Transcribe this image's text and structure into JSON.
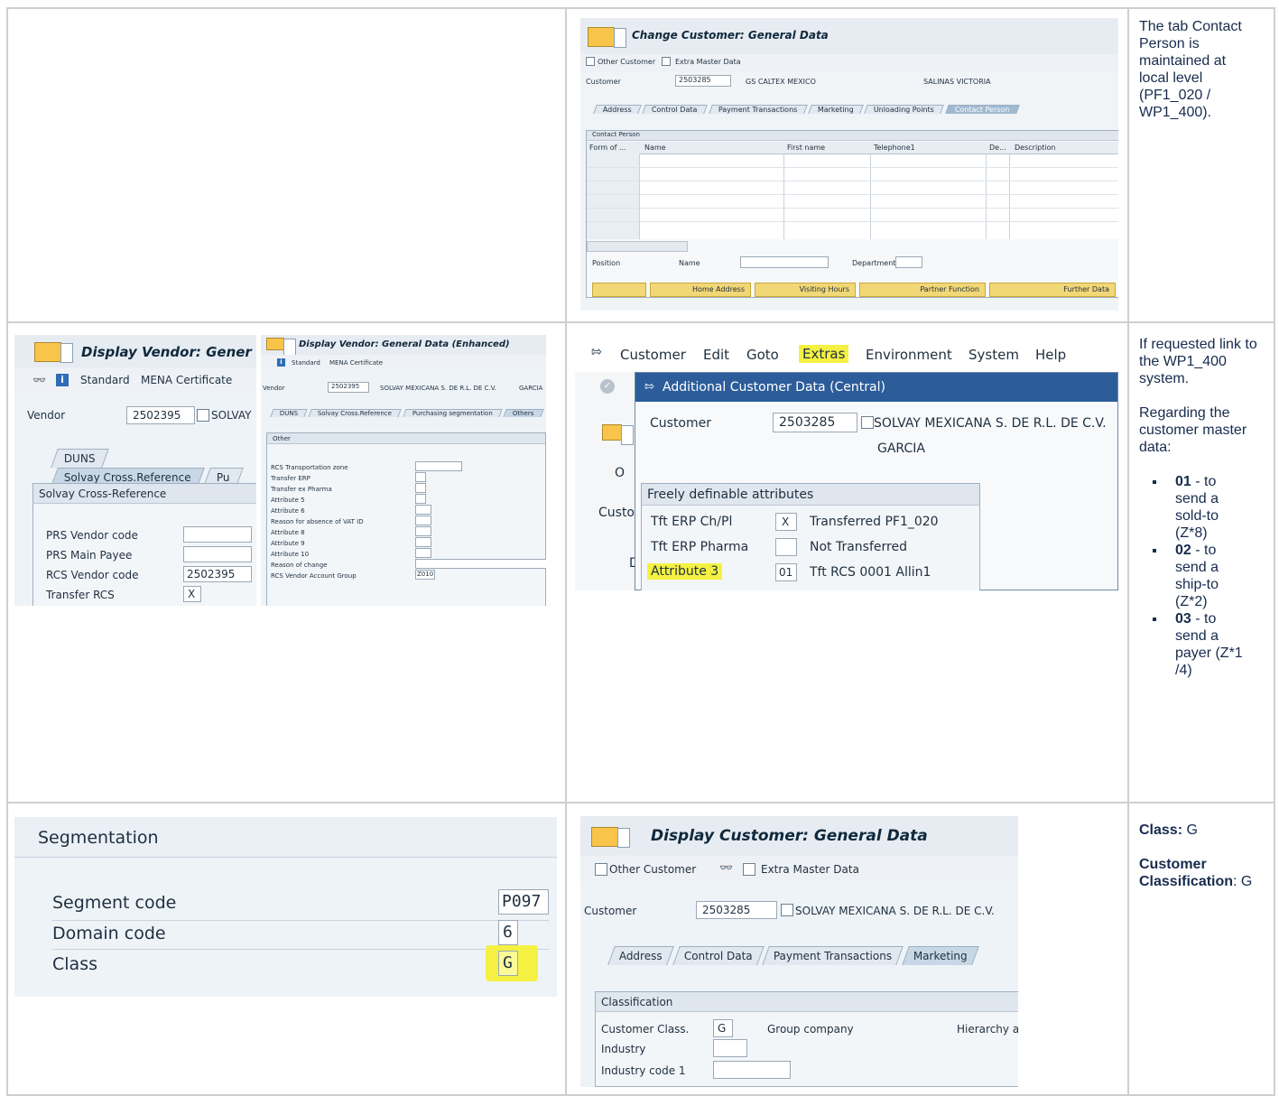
{
  "notes": {
    "row1": "The tab Contact Person is maintained at local level (PF1_020 / WP1_400).",
    "row2_p1": "If requested link to the WP1_400 system.",
    "row2_p2": "Regarding the customer master data:",
    "row2_items": [
      {
        "code": "01",
        "text": " - to send a sold-to (Z*8)"
      },
      {
        "code": "02",
        "text": " - to send a ship-to (Z*2)"
      },
      {
        "code": "03",
        "text": " - to send a payer (Z*1 /4)"
      }
    ],
    "row3_class_label": "Class:",
    "row3_class_value": " G",
    "row3_cc_label": "Customer Classification",
    "row3_cc_value": ": G"
  },
  "shot_change_customer": {
    "title": "Change Customer: General Data",
    "toolbar": [
      "Other Customer",
      "Extra Master Data"
    ],
    "customer_label": "Customer",
    "customer_no": "2503285",
    "customer_name": "GS CALTEX MEXICO",
    "city": "SALINAS VICTORIA",
    "tabs": [
      "Address",
      "Control Data",
      "Payment Transactions",
      "Marketing",
      "Unloading Points",
      "Contact Person"
    ],
    "group_title": "Contact Person",
    "columns": [
      "Form of ...",
      "Name",
      "First name",
      "Telephone1",
      "De...",
      "Description"
    ],
    "position_label": "Position",
    "name_label": "Name",
    "department_label": "Department",
    "buttons": [
      "Home Address",
      "Visiting Hours",
      "Partner Function",
      "Further Data"
    ]
  },
  "shot_vendor_large": {
    "title": "Display Vendor: Gener",
    "toolbar": [
      "Standard",
      "MENA Certificate"
    ],
    "vendor_label": "Vendor",
    "vendor_no": "2502395",
    "vendor_name": "SOLVAY",
    "tabs": [
      "DUNS",
      "Solvay Cross.Reference",
      "Pu"
    ],
    "group_title": "Solvay Cross-Reference",
    "fields": [
      {
        "label": "PRS Vendor code",
        "value": ""
      },
      {
        "label": "PRS Main Payee",
        "value": ""
      },
      {
        "label": "RCS Vendor code",
        "value": "2502395"
      },
      {
        "label": "Transfer RCS",
        "value": "X"
      }
    ]
  },
  "shot_vendor_small": {
    "title": "Display Vendor: General Data (Enhanced)",
    "toolbar": [
      "Standard",
      "MENA Certificate"
    ],
    "vendor_label": "Vendor",
    "vendor_no": "2502395",
    "vendor_name": "SOLVAY MEXICANA S. DE R.L. DE C.V.",
    "vendor_city": "GARCIA",
    "tabs": [
      "DUNS",
      "Solvay Cross.Reference",
      "Purchasing segmentation",
      "Others"
    ],
    "group_title": "Other",
    "fields": [
      {
        "label": "RCS Transportation zone",
        "value": ""
      },
      {
        "label": "Transfer ERP",
        "value": ""
      },
      {
        "label": "Transfer ex Pharma",
        "value": ""
      },
      {
        "label": "Attribute 5",
        "value": ""
      },
      {
        "label": "Attribute 6",
        "value": ""
      },
      {
        "label": "Reason for absence of VAT ID",
        "value": ""
      },
      {
        "label": "Attribute 8",
        "value": ""
      },
      {
        "label": "Attribute 9",
        "value": ""
      },
      {
        "label": "Attribute 10",
        "value": ""
      },
      {
        "label": "Reason of change",
        "value": ""
      },
      {
        "label": "RCS Vendor Account Group",
        "value": "Z010"
      }
    ]
  },
  "shot_additional": {
    "menu": [
      "Customer",
      "Edit",
      "Goto",
      "Extras",
      "Environment",
      "System",
      "Help"
    ],
    "dialog_title": "Additional Customer Data (Central)",
    "customer_label": "Customer",
    "customer_no": "2503285",
    "customer_name": "SOLVAY MEXICANA S. DE R.L. DE C.V.",
    "city": "GARCIA",
    "bg_fragments": [
      "O",
      "Custo",
      "D"
    ],
    "group_title": "Freely definable attributes",
    "rows": [
      {
        "label": "Tft ERP Ch/Pl",
        "value": "X",
        "desc": "Transferred PF1_020"
      },
      {
        "label": "Tft ERP Pharma",
        "value": "",
        "desc": "Not Transferred"
      },
      {
        "label": "Attribute 3",
        "value": "01",
        "desc": "Tft RCS 0001 Allin1"
      }
    ]
  },
  "shot_segmentation": {
    "title": "Segmentation",
    "fields": [
      {
        "label": "Segment code",
        "value": "P097"
      },
      {
        "label": "Domain code",
        "value": "6"
      },
      {
        "label": "Class",
        "value": "G"
      }
    ]
  },
  "shot_display_customer": {
    "title": "Display Customer: General Data",
    "toolbar": [
      "Other Customer",
      "Extra Master Data"
    ],
    "customer_label": "Customer",
    "customer_no": "2503285",
    "customer_name": "SOLVAY MEXICANA S. DE R.L. DE C.V.",
    "tabs": [
      "Address",
      "Control Data",
      "Payment Transactions",
      "Marketing"
    ],
    "group_title": "Classification",
    "fields": [
      {
        "label": "Customer Class.",
        "value": "G",
        "desc": "Group company"
      },
      {
        "label": "Industry",
        "value": "",
        "desc": ""
      },
      {
        "label": "Industry code 1",
        "value": "",
        "desc": ""
      }
    ],
    "hierarchy_fragment": "Hierarchy a"
  }
}
